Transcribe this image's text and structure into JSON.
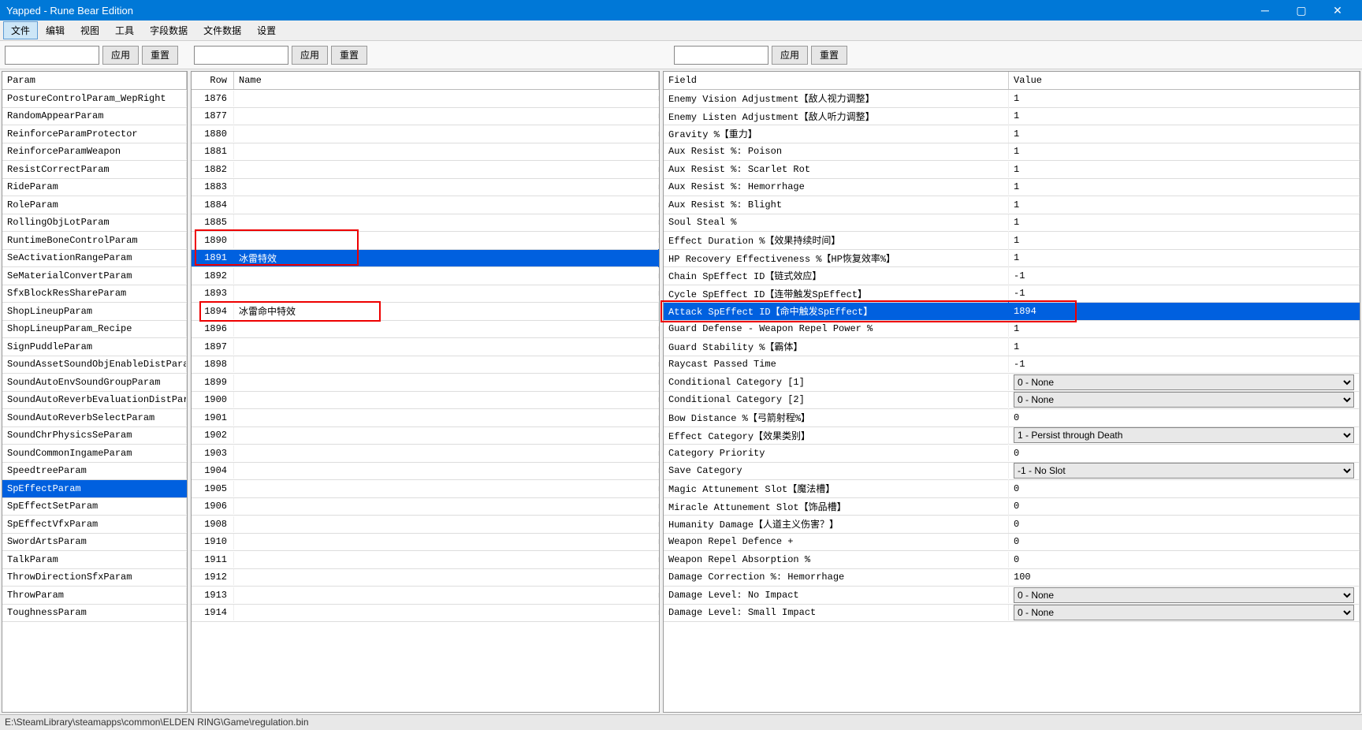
{
  "title": "Yapped - Rune Bear Edition",
  "menu": [
    "文件",
    "编辑",
    "视图",
    "工具",
    "字段数据",
    "文件数据",
    "设置"
  ],
  "menu_active": 0,
  "btn_apply": "应用",
  "btn_reset": "重置",
  "panel1": {
    "header": "Param",
    "items": [
      "PostureControlParam_WepRight",
      "RandomAppearParam",
      "ReinforceParamProtector",
      "ReinforceParamWeapon",
      "ResistCorrectParam",
      "RideParam",
      "RoleParam",
      "RollingObjLotParam",
      "RuntimeBoneControlParam",
      "SeActivationRangeParam",
      "SeMaterialConvertParam",
      "SfxBlockResShareParam",
      "ShopLineupParam",
      "ShopLineupParam_Recipe",
      "SignPuddleParam",
      "SoundAssetSoundObjEnableDistParam",
      "SoundAutoEnvSoundGroupParam",
      "SoundAutoReverbEvaluationDistParam",
      "SoundAutoReverbSelectParam",
      "SoundChrPhysicsSeParam",
      "SoundCommonIngameParam",
      "SpeedtreeParam",
      "SpEffectParam",
      "SpEffectSetParam",
      "SpEffectVfxParam",
      "SwordArtsParam",
      "TalkParam",
      "ThrowDirectionSfxParam",
      "ThrowParam",
      "ToughnessParam"
    ],
    "selected": 22
  },
  "panel2": {
    "header_row": "Row",
    "header_name": "Name",
    "items": [
      {
        "row": 1876,
        "name": ""
      },
      {
        "row": 1877,
        "name": ""
      },
      {
        "row": 1880,
        "name": ""
      },
      {
        "row": 1881,
        "name": ""
      },
      {
        "row": 1882,
        "name": ""
      },
      {
        "row": 1883,
        "name": ""
      },
      {
        "row": 1884,
        "name": ""
      },
      {
        "row": 1885,
        "name": ""
      },
      {
        "row": 1890,
        "name": ""
      },
      {
        "row": 1891,
        "name": "冰雷特效"
      },
      {
        "row": 1892,
        "name": ""
      },
      {
        "row": 1893,
        "name": ""
      },
      {
        "row": 1894,
        "name": "冰雷命中特效"
      },
      {
        "row": 1896,
        "name": ""
      },
      {
        "row": 1897,
        "name": ""
      },
      {
        "row": 1898,
        "name": ""
      },
      {
        "row": 1899,
        "name": ""
      },
      {
        "row": 1900,
        "name": ""
      },
      {
        "row": 1901,
        "name": ""
      },
      {
        "row": 1902,
        "name": ""
      },
      {
        "row": 1903,
        "name": ""
      },
      {
        "row": 1904,
        "name": ""
      },
      {
        "row": 1905,
        "name": ""
      },
      {
        "row": 1906,
        "name": ""
      },
      {
        "row": 1908,
        "name": ""
      },
      {
        "row": 1910,
        "name": ""
      },
      {
        "row": 1911,
        "name": ""
      },
      {
        "row": 1912,
        "name": ""
      },
      {
        "row": 1913,
        "name": ""
      },
      {
        "row": 1914,
        "name": ""
      }
    ],
    "selected": 9
  },
  "panel3": {
    "header_field": "Field",
    "header_value": "Value",
    "items": [
      {
        "f": "Enemy Vision Adjustment【敌人视力调整】",
        "v": "1"
      },
      {
        "f": "Enemy Listen Adjustment【敌人听力调整】",
        "v": "1"
      },
      {
        "f": "Gravity %【重力】",
        "v": "1"
      },
      {
        "f": "Aux Resist %: Poison",
        "v": "1"
      },
      {
        "f": "Aux Resist %: Scarlet Rot",
        "v": "1"
      },
      {
        "f": "Aux Resist %: Hemorrhage",
        "v": "1"
      },
      {
        "f": "Aux Resist %: Blight",
        "v": "1"
      },
      {
        "f": "Soul Steal %",
        "v": "1"
      },
      {
        "f": "Effect Duration %【效果持续时间】",
        "v": "1"
      },
      {
        "f": "HP Recovery Effectiveness %【HP恢复效率%】",
        "v": "1"
      },
      {
        "f": "Chain SpEffect ID【链式效应】",
        "v": "-1"
      },
      {
        "f": "Cycle SpEffect ID【连带触发SpEffect】",
        "v": "-1"
      },
      {
        "f": "Attack SpEffect ID【命中触发SpEffect】",
        "v": "1894"
      },
      {
        "f": "Guard Defense - Weapon Repel Power %",
        "v": "1"
      },
      {
        "f": "Guard Stability %【霸体】",
        "v": "1"
      },
      {
        "f": "Raycast Passed Time",
        "v": "-1"
      },
      {
        "f": "Conditional Category [1]",
        "v": "0 - None",
        "dd": true
      },
      {
        "f": "Conditional Category [2]",
        "v": "0 - None",
        "dd": true
      },
      {
        "f": "Bow Distance %【弓箭射程%】",
        "v": "0"
      },
      {
        "f": "Effect Category【效果类别】",
        "v": "1 - Persist through Death",
        "dd": true
      },
      {
        "f": "Category Priority",
        "v": "0"
      },
      {
        "f": "Save Category",
        "v": "-1 - No Slot",
        "dd": true
      },
      {
        "f": "Magic Attunement Slot【魔法槽】",
        "v": "0"
      },
      {
        "f": "Miracle Attunement Slot【饰品槽】",
        "v": "0"
      },
      {
        "f": "Humanity Damage【人道主义伤害？】",
        "v": "0"
      },
      {
        "f": "Weapon Repel Defence +",
        "v": "0"
      },
      {
        "f": "Weapon Repel Absorption %",
        "v": "0"
      },
      {
        "f": "Damage Correction %: Hemorrhage",
        "v": "100"
      },
      {
        "f": "Damage Level: No Impact",
        "v": "0 - None",
        "dd": true
      },
      {
        "f": "Damage Level: Small Impact",
        "v": "0 - None",
        "dd": true
      }
    ],
    "selected": 12
  },
  "status": "E:\\SteamLibrary\\steamapps\\common\\ELDEN RING\\Game\\regulation.bin"
}
